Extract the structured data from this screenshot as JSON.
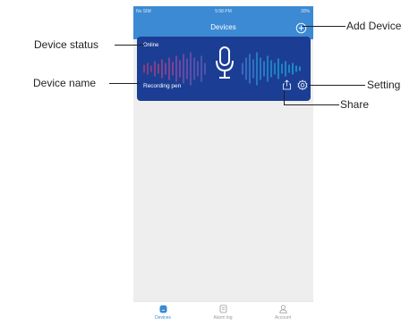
{
  "status_bar": {
    "carrier": "No SIM",
    "time": "5:58 PM",
    "battery": "30%"
  },
  "nav": {
    "title": "Devices",
    "add_icon": "plus-circle-icon"
  },
  "device_card": {
    "status": "Online",
    "name": "Recording pen",
    "share_icon": "share-icon",
    "settings_icon": "gear-icon",
    "device_icon": "microphone-icon"
  },
  "tabs": [
    {
      "label": "Devices",
      "icon": "device-icon",
      "active": true
    },
    {
      "label": "Alarm log",
      "icon": "alarm-log-icon",
      "active": false
    },
    {
      "label": "Account",
      "icon": "account-icon",
      "active": false
    }
  ],
  "callouts": {
    "add_device": "Add Device",
    "device_status": "Device status",
    "device_name": "Device name",
    "setting": "Setting",
    "share": "Share"
  },
  "colors": {
    "primary": "#3c8ad3",
    "card": "#1b3e94",
    "background": "#eeeeef"
  }
}
